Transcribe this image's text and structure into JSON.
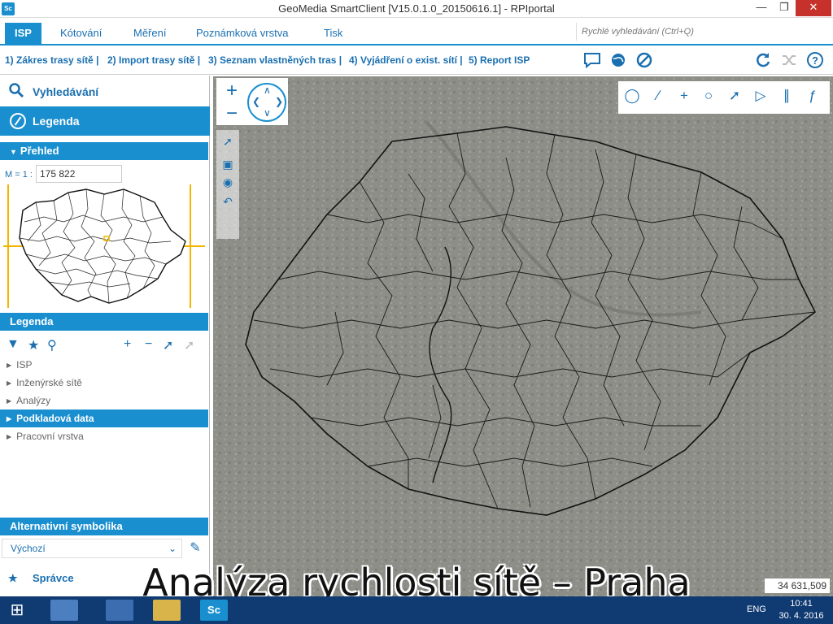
{
  "window": {
    "app_icon": "Sc",
    "title": "GeoMedia SmartClient  [V15.0.1.0_20150616.1] - RPIportal",
    "minimize_icon": "minimize-icon",
    "maximize_icon": "maximize-icon",
    "close_icon": "close-icon"
  },
  "ribbon": {
    "tabs": [
      "ISP",
      "Kótování",
      "Měření",
      "Poznámková vrstva",
      "Tisk"
    ],
    "active_tab": "ISP",
    "quick_search_placeholder": "Rychlé vyhledávání (Ctrl+Q)"
  },
  "toolbar": {
    "links": [
      "1) Zákres trasy sítě |",
      "2) Import trasy sítě |",
      "3) Seznam vlastněných tras |",
      "4) Vyjádření o exist. sítí |",
      "5) Report ISP"
    ],
    "icons": [
      "comment-icon",
      "globe-icon",
      "cancel-icon",
      "refresh-icon",
      "shuffle-icon",
      "help-icon"
    ]
  },
  "sidebar": {
    "search_label": "Vyhledávání",
    "legend_label": "Legenda",
    "overview": {
      "label": "Přehled",
      "scale_label": "M = 1 :",
      "scale_value": "175 822"
    },
    "legend_panel": {
      "label": "Legenda",
      "items": [
        {
          "label": "ISP",
          "selected": false
        },
        {
          "label": "Inženýrské sítě",
          "selected": false
        },
        {
          "label": "Analýzy",
          "selected": false
        },
        {
          "label": "Podkladová data",
          "selected": true
        },
        {
          "label": "Pracovní vrstva",
          "selected": false
        }
      ]
    },
    "alt_symbology": {
      "label": "Alternativní symbolika",
      "selected": "Výchozí"
    },
    "management_label": "Správce"
  },
  "map": {
    "coordinate": "34 631,509"
  },
  "caption": "Analýza rychlosti sítě – Praha",
  "taskbar": {
    "language": "ENG",
    "time": "10:41",
    "date": "30. 4. 2016",
    "sc_label": "Sc"
  }
}
